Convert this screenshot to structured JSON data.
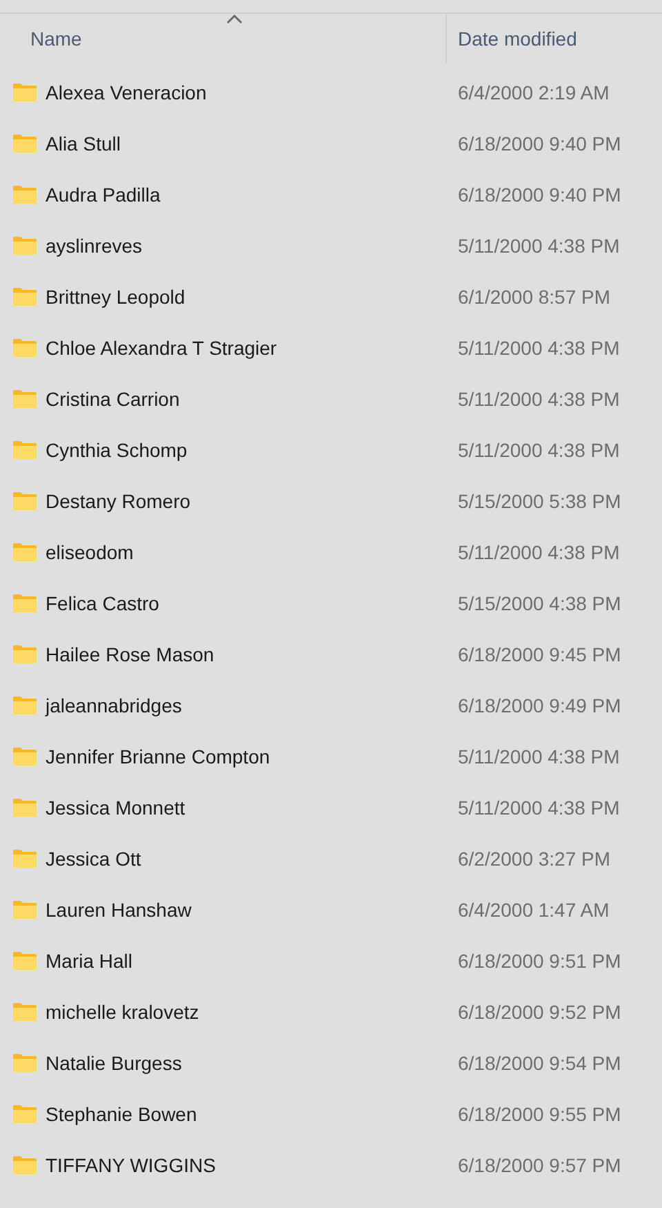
{
  "columns": [
    {
      "label": "Name",
      "sorted": true
    },
    {
      "label": "Date modified",
      "sorted": false
    }
  ],
  "rows": [
    {
      "name": "Alexea Veneracion",
      "date_modified": "6/4/2000 2:19 AM"
    },
    {
      "name": "Alia Stull",
      "date_modified": "6/18/2000 9:40 PM"
    },
    {
      "name": "Audra Padilla",
      "date_modified": "6/18/2000 9:40 PM"
    },
    {
      "name": "ayslinreves",
      "date_modified": "5/11/2000 4:38 PM"
    },
    {
      "name": "Brittney Leopold",
      "date_modified": "6/1/2000 8:57 PM"
    },
    {
      "name": "Chloe Alexandra T Stragier",
      "date_modified": "5/11/2000 4:38 PM"
    },
    {
      "name": "Cristina Carrion",
      "date_modified": "5/11/2000 4:38 PM"
    },
    {
      "name": "Cynthia Schomp",
      "date_modified": "5/11/2000 4:38 PM"
    },
    {
      "name": "Destany Romero",
      "date_modified": "5/15/2000 5:38 PM"
    },
    {
      "name": "eliseodom",
      "date_modified": "5/11/2000 4:38 PM"
    },
    {
      "name": "Felica Castro",
      "date_modified": "5/15/2000 4:38 PM"
    },
    {
      "name": "Hailee Rose Mason",
      "date_modified": "6/18/2000 9:45 PM"
    },
    {
      "name": "jaleannabridges",
      "date_modified": "6/18/2000 9:49 PM"
    },
    {
      "name": "Jennifer Brianne Compton",
      "date_modified": "5/11/2000 4:38 PM"
    },
    {
      "name": "Jessica Monnett",
      "date_modified": "5/11/2000 4:38 PM"
    },
    {
      "name": "Jessica Ott",
      "date_modified": "6/2/2000 3:27 PM"
    },
    {
      "name": "Lauren Hanshaw",
      "date_modified": "6/4/2000 1:47 AM"
    },
    {
      "name": "Maria Hall",
      "date_modified": "6/18/2000 9:51 PM"
    },
    {
      "name": "michelle kralovetz",
      "date_modified": "6/18/2000 9:52 PM"
    },
    {
      "name": "Natalie Burgess",
      "date_modified": "6/18/2000 9:54 PM"
    },
    {
      "name": "Stephanie Bowen",
      "date_modified": "6/18/2000 9:55 PM"
    },
    {
      "name": "TIFFANY WIGGINS",
      "date_modified": "6/18/2000 9:57 PM"
    }
  ]
}
